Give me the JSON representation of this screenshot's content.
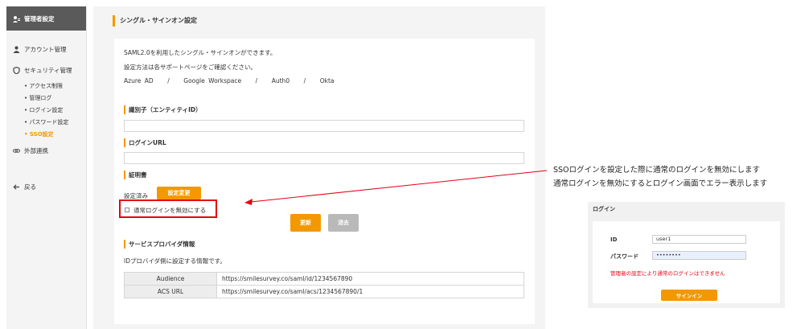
{
  "sidebar": {
    "header": "管理者設定",
    "account": "アカウント管理",
    "security": "セキュリティ管理",
    "sub_items": [
      "アクセス制限",
      "管理ログ",
      "ログイン設定",
      "パスワード設定",
      "SSO設定"
    ],
    "external": "外部連携",
    "back": "戻る"
  },
  "page": {
    "title": "シングル・サインオン設定",
    "intro_line1": "SAML2.0を利用したシングル・サインオンができます。",
    "intro_line2": "設定方法は各サポートページをご確認ください。",
    "providers": [
      "Azure AD",
      "/",
      "Google Workspace",
      "/",
      "Auth0",
      "/",
      "Okta"
    ],
    "entity_id_label": "識別子（エンティティID）",
    "entity_id_value": "",
    "login_url_label": "ログインURL",
    "login_url_value": "",
    "cert_label": "証明書",
    "cert_status": "設定済み",
    "cert_change_button": "設定変更",
    "disable_normal_login_label": "通常ログインを無効にする",
    "update_button": "更新",
    "clear_button": "消去",
    "sp_section_label": "サービスプロバイダ情報",
    "sp_description": "IDプロバイダ側に設定する情報です。",
    "sp_rows": [
      {
        "label": "Audience",
        "value": "https://smilesurvey.co/saml/id/1234567890"
      },
      {
        "label": "ACS URL",
        "value": "https://smilesurvey.co/saml/acs/1234567890/1"
      }
    ]
  },
  "annotation": {
    "line1": "SSOログインを設定した際に通常のログインを無効にします",
    "line2": "通常ログインを無効にするとログイン画面でエラー表示します"
  },
  "login_preview": {
    "title": "ログイン",
    "id_label": "ID",
    "id_value": "user1",
    "password_label": "パスワード",
    "password_value": "••••••••",
    "error": "管理者の設定により通常のログインはできません",
    "signin_button": "サインイン"
  },
  "colors": {
    "accent": "#f39800",
    "error": "#e60012",
    "sidebar_header": "#5a5a5a"
  }
}
